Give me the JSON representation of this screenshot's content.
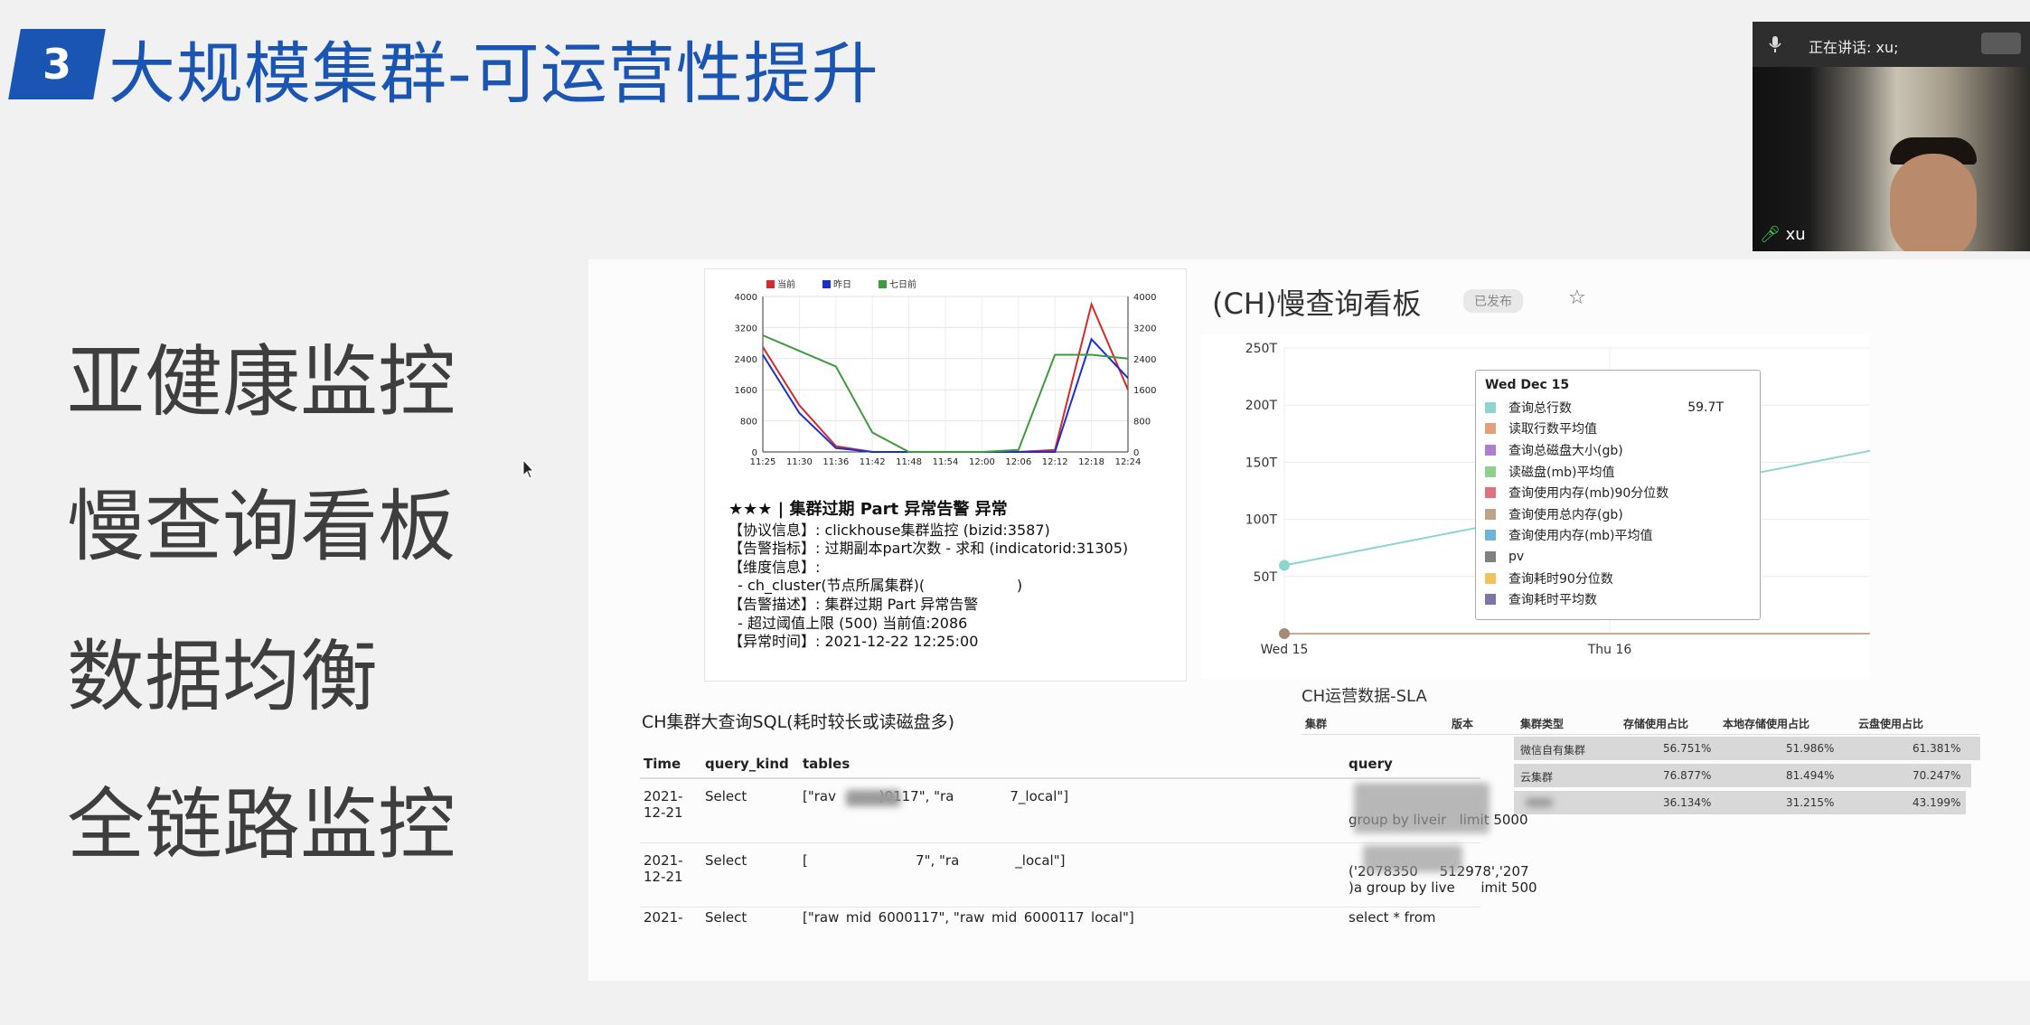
{
  "slide": {
    "number": "3",
    "title": "大规模集群-可运营性提升",
    "bullets": [
      "亚健康监控",
      "慢查询看板",
      "数据均衡",
      "全链路监控"
    ]
  },
  "webcam": {
    "speaking_label": "正在讲话: xu;",
    "participant_name": "xu"
  },
  "alert_card": {
    "legend": [
      "当前",
      "昨日",
      "七日前"
    ],
    "colors": {
      "current": "#d42a2a",
      "yesterday": "#1a2fd0",
      "week_ago": "#3d9a3d"
    },
    "chart_data": {
      "type": "line",
      "x": [
        "11:25",
        "11:30",
        "11:36",
        "11:42",
        "11:48",
        "11:54",
        "12:00",
        "12:06",
        "12:12",
        "12:18",
        "12:24"
      ],
      "ylim": [
        0,
        4000
      ],
      "yticks": [
        "4000",
        "3200",
        "2400",
        "1600",
        "800",
        "0"
      ],
      "series": [
        {
          "name": "当前",
          "values": [
            2700,
            1200,
            150,
            0,
            0,
            0,
            0,
            0,
            50,
            3800,
            1600
          ]
        },
        {
          "name": "昨日",
          "values": [
            2500,
            1000,
            100,
            0,
            0,
            0,
            0,
            0,
            0,
            2900,
            1900
          ]
        },
        {
          "name": "七日前",
          "values": [
            3000,
            2600,
            2200,
            500,
            0,
            0,
            0,
            50,
            2500,
            2500,
            2400
          ]
        }
      ]
    },
    "title": "★★★ | 集群过期 Part 异常告警 异常",
    "lines": [
      "【协议信息】: clickhouse集群监控 (bizid:3587)",
      "【告警指标】: 过期副本part次数 - 求和 (indicatorid:31305)",
      "【维度信息】:",
      "  - ch_cluster(节点所属集群)(                    )",
      "【告警描述】: 集群过期 Part 异常告警",
      "  - 超过阈值上限 (500) 当前值:2086",
      "【异常时间】: 2021-12-22 12:25:00"
    ]
  },
  "slow_board": {
    "title": "(CH)慢查询看板",
    "status_badge": "已发布",
    "chart_data": {
      "type": "line",
      "x": [
        "Wed 15",
        "Thu 16"
      ],
      "yticks": [
        "250T",
        "200T",
        "150T",
        "100T",
        "50T"
      ],
      "ylim": [
        0,
        250
      ],
      "series": [
        {
          "name": "查询总行数",
          "values": [
            59.7,
            160
          ]
        }
      ]
    },
    "tooltip": {
      "title": "Wed Dec 15",
      "items": [
        {
          "label": "查询总行数",
          "color": "#8ed4cf",
          "value": "59.7T"
        },
        {
          "label": "读取行数平均值",
          "color": "#e4a07a",
          "value": ""
        },
        {
          "label": "查询总磁盘大小(gb)",
          "color": "#b07ecf",
          "value": ""
        },
        {
          "label": "读磁盘(mb)平均值",
          "color": "#8fd08f",
          "value": ""
        },
        {
          "label": "查询使用内存(mb)90分位数",
          "color": "#e0707c",
          "value": ""
        },
        {
          "label": "查询使用总内存(gb)",
          "color": "#bfa48c",
          "value": ""
        },
        {
          "label": "查询使用内存(mb)平均值",
          "color": "#6fb3d6",
          "value": ""
        },
        {
          "label": "pv",
          "color": "#808080",
          "value": ""
        },
        {
          "label": "查询耗时90分位数",
          "color": "#f0c35a",
          "value": ""
        },
        {
          "label": "查询耗时平均数",
          "color": "#7b76a6",
          "value": ""
        }
      ]
    }
  },
  "sql_panel": {
    "title": "CH集群大查询SQL(耗时较长或读磁盘多)",
    "columns": [
      "Time",
      "query_kind",
      "tables",
      "query"
    ],
    "rows": [
      {
        "time": "2021-\n12-21",
        "kind": "Select",
        "tables": "[\"rav          )0117\", \"ra             7_local\"]",
        "query": "group by liveir   limit 5000"
      },
      {
        "time": "2021-\n12-21",
        "kind": "Select",
        "tables": "[                         7\", \"ra             _local\"]",
        "query": "('2078350     512978','207\n)a group by live      imit 500"
      },
      {
        "time": "2021-",
        "kind": "Select",
        "tables": "[\"raw_mid_6000117\", \"raw_mid_6000117_local\"]",
        "query": "select * from (select liveid, as"
      }
    ]
  },
  "sla_panel": {
    "title": "CH运营数据-SLA",
    "columns": [
      "集群",
      "版本",
      "集群类型",
      "存储使用占比",
      "本地存储使用占比",
      "云盘使用占比"
    ],
    "rows": [
      {
        "type": "微信自有集群",
        "storage": "56.751%",
        "local": "51.986%",
        "cloud": "61.381%"
      },
      {
        "type": "云集群",
        "storage": "76.877%",
        "local": "81.494%",
        "cloud": "70.247%"
      },
      {
        "type": "",
        "storage": "36.134%",
        "local": "31.215%",
        "cloud": "43.199%"
      }
    ]
  }
}
